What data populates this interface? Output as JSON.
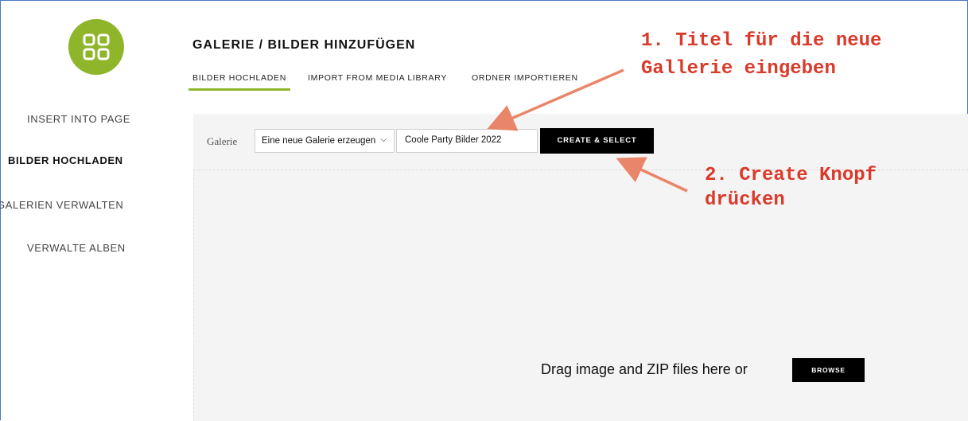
{
  "sidebar": {
    "items": [
      {
        "label": "INSERT INTO PAGE",
        "active": false
      },
      {
        "label": "BILDER HOCHLADEN",
        "active": true
      },
      {
        "label": "GALERIEN VERWALTEN",
        "active": false
      },
      {
        "label": "VERWALTE ALBEN",
        "active": false
      }
    ]
  },
  "header": {
    "title": "GALERIE / BILDER HINZUFÜGEN",
    "tabs": [
      {
        "label": "BILDER HOCHLADEN",
        "active": true
      },
      {
        "label": "IMPORT FROM MEDIA LIBRARY",
        "active": false
      },
      {
        "label": "ORDNER IMPORTIEREN",
        "active": false
      }
    ]
  },
  "form": {
    "gallery_label": "Galerie",
    "select_value": "Eine neue Galerie erzeugen",
    "title_input_value": "Coole Party Bilder 2022",
    "create_button": "CREATE & SELECT"
  },
  "dropzone": {
    "text": "Drag image and ZIP files here or",
    "browse_button": "BROWSE"
  },
  "annotations": {
    "step1_line1": "1. Titel für die neue",
    "step1_line2": "Gallerie eingeben",
    "step2_line1": "2. Create Knopf",
    "step2_line2": "drücken"
  },
  "colors": {
    "accent": "#8fb52a",
    "annotation": "#d93a2a",
    "arrow": "#e9866a"
  },
  "icons": {
    "logo": "grid-apps-icon",
    "select_caret": "chevron-down-icon"
  }
}
